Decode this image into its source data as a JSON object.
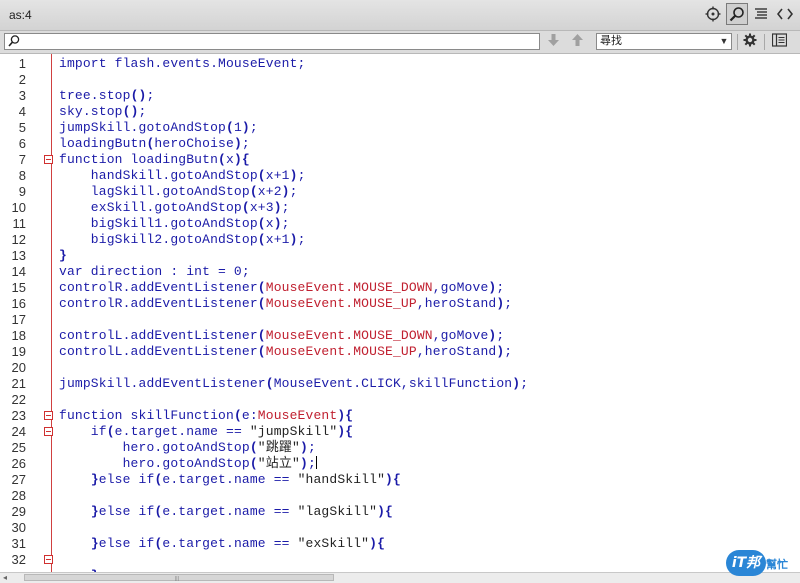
{
  "window": {
    "tab_title": "as:4"
  },
  "toolbar_icons": [
    "target-icon",
    "search-icon",
    "format-icon",
    "code-hint-icon"
  ],
  "findbar": {
    "search_value": "",
    "mode_select": "尋找",
    "icons": [
      "search-icon",
      "arrow-down-icon",
      "arrow-up-icon",
      "gear-icon",
      "panel-icon"
    ]
  },
  "line_numbers": [
    "1",
    "2",
    "3",
    "4",
    "5",
    "6",
    "7",
    "8",
    "9",
    "10",
    "11",
    "12",
    "13",
    "14",
    "15",
    "16",
    "17",
    "18",
    "19",
    "20",
    "21",
    "22",
    "23",
    "24",
    "25",
    "26",
    "27",
    "28",
    "29",
    "30",
    "31",
    "32"
  ],
  "fold_marker_lines": [
    7,
    23,
    24,
    32
  ],
  "code_lines": [
    [
      [
        "k",
        "import flash.events.MouseEvent;"
      ]
    ],
    [],
    [
      [
        "k",
        "tree.stop"
      ],
      [
        "p",
        "()"
      ],
      [
        "k",
        ";"
      ]
    ],
    [
      [
        "k",
        "sky.stop"
      ],
      [
        "p",
        "()"
      ],
      [
        "k",
        ";"
      ]
    ],
    [
      [
        "k",
        "jumpSkill.gotoAndStop"
      ],
      [
        "p",
        "("
      ],
      [
        "k",
        "1"
      ],
      [
        "p",
        ")"
      ],
      [
        "k",
        ";"
      ]
    ],
    [
      [
        "k",
        "loadingButn"
      ],
      [
        "p",
        "("
      ],
      [
        "k",
        "heroChoise"
      ],
      [
        "p",
        ")"
      ],
      [
        "k",
        ";"
      ]
    ],
    [
      [
        "k",
        "function loadingButn"
      ],
      [
        "p",
        "("
      ],
      [
        "k",
        "x"
      ],
      [
        "p",
        ")"
      ],
      [
        "p",
        "{"
      ]
    ],
    [
      [
        "k",
        "    handSkill.gotoAndStop"
      ],
      [
        "p",
        "("
      ],
      [
        "k",
        "x+1"
      ],
      [
        "p",
        ")"
      ],
      [
        "k",
        ";"
      ]
    ],
    [
      [
        "k",
        "    lagSkill.gotoAndStop"
      ],
      [
        "p",
        "("
      ],
      [
        "k",
        "x+2"
      ],
      [
        "p",
        ")"
      ],
      [
        "k",
        ";"
      ]
    ],
    [
      [
        "k",
        "    exSkill.gotoAndStop"
      ],
      [
        "p",
        "("
      ],
      [
        "k",
        "x+3"
      ],
      [
        "p",
        ")"
      ],
      [
        "k",
        ";"
      ]
    ],
    [
      [
        "k",
        "    bigSkill1.gotoAndStop"
      ],
      [
        "p",
        "("
      ],
      [
        "k",
        "x"
      ],
      [
        "p",
        ")"
      ],
      [
        "k",
        ";"
      ]
    ],
    [
      [
        "k",
        "    bigSkill2.gotoAndStop"
      ],
      [
        "p",
        "("
      ],
      [
        "k",
        "x+1"
      ],
      [
        "p",
        ")"
      ],
      [
        "k",
        ";"
      ]
    ],
    [
      [
        "p",
        "}"
      ]
    ],
    [
      [
        "k",
        "var direction : int = 0;"
      ]
    ],
    [
      [
        "k",
        "controlR.addEventListener"
      ],
      [
        "p",
        "("
      ],
      [
        "r",
        "MouseEvent.MOUSE_DOWN"
      ],
      [
        "k",
        ",goMove"
      ],
      [
        "p",
        ")"
      ],
      [
        "k",
        ";"
      ]
    ],
    [
      [
        "k",
        "controlR.addEventListener"
      ],
      [
        "p",
        "("
      ],
      [
        "r",
        "MouseEvent.MOUSE_UP"
      ],
      [
        "k",
        ",heroStand"
      ],
      [
        "p",
        ")"
      ],
      [
        "k",
        ";"
      ]
    ],
    [],
    [
      [
        "k",
        "controlL.addEventListener"
      ],
      [
        "p",
        "("
      ],
      [
        "r",
        "MouseEvent.MOUSE_DOWN"
      ],
      [
        "k",
        ",goMove"
      ],
      [
        "p",
        ")"
      ],
      [
        "k",
        ";"
      ]
    ],
    [
      [
        "k",
        "controlL.addEventListener"
      ],
      [
        "p",
        "("
      ],
      [
        "r",
        "MouseEvent.MOUSE_UP"
      ],
      [
        "k",
        ",heroStand"
      ],
      [
        "p",
        ")"
      ],
      [
        "k",
        ";"
      ]
    ],
    [],
    [
      [
        "k",
        "jumpSkill.addEventListener"
      ],
      [
        "p",
        "("
      ],
      [
        "k",
        "MouseEvent.CLICK,skillFunction"
      ],
      [
        "p",
        ")"
      ],
      [
        "k",
        ";"
      ]
    ],
    [],
    [
      [
        "k",
        "function skillFunction"
      ],
      [
        "p",
        "("
      ],
      [
        "k",
        "e:"
      ],
      [
        "r",
        "MouseEvent"
      ],
      [
        "p",
        ")"
      ],
      [
        "p",
        "{"
      ]
    ],
    [
      [
        "k",
        "    if"
      ],
      [
        "p",
        "("
      ],
      [
        "k",
        "e.target.name == "
      ],
      [
        "s",
        "\"jumpSkill\""
      ],
      [
        "p",
        ")"
      ],
      [
        "p",
        "{"
      ]
    ],
    [
      [
        "k",
        "        hero.gotoAndStop"
      ],
      [
        "p",
        "("
      ],
      [
        "s",
        "\"跳躍\""
      ],
      [
        "p",
        ")"
      ],
      [
        "k",
        ";"
      ]
    ],
    [
      [
        "k",
        "        hero.gotoAndStop"
      ],
      [
        "p",
        "("
      ],
      [
        "s",
        "\"站立\""
      ],
      [
        "p",
        ")"
      ],
      [
        "k",
        ";"
      ],
      [
        "c",
        ""
      ]
    ],
    [
      [
        "k",
        "    "
      ],
      [
        "p",
        "}"
      ],
      [
        "k",
        "else if"
      ],
      [
        "p",
        "("
      ],
      [
        "k",
        "e.target.name == "
      ],
      [
        "s",
        "\"handSkill\""
      ],
      [
        "p",
        ")"
      ],
      [
        "p",
        "{"
      ]
    ],
    [],
    [
      [
        "k",
        "    "
      ],
      [
        "p",
        "}"
      ],
      [
        "k",
        "else if"
      ],
      [
        "p",
        "("
      ],
      [
        "k",
        "e.target.name == "
      ],
      [
        "s",
        "\"lagSkill\""
      ],
      [
        "p",
        ")"
      ],
      [
        "p",
        "{"
      ]
    ],
    [],
    [
      [
        "k",
        "    "
      ],
      [
        "p",
        "}"
      ],
      [
        "k",
        "else if"
      ],
      [
        "p",
        "("
      ],
      [
        "k",
        "e.target.name == "
      ],
      [
        "s",
        "\"exSkill\""
      ],
      [
        "p",
        ")"
      ],
      [
        "p",
        "{"
      ]
    ],
    [],
    [
      [
        "k",
        "    "
      ],
      [
        "p",
        "}"
      ]
    ]
  ],
  "watermark": {
    "logo_text": "iT邦",
    "sub_text": "幫忙"
  }
}
